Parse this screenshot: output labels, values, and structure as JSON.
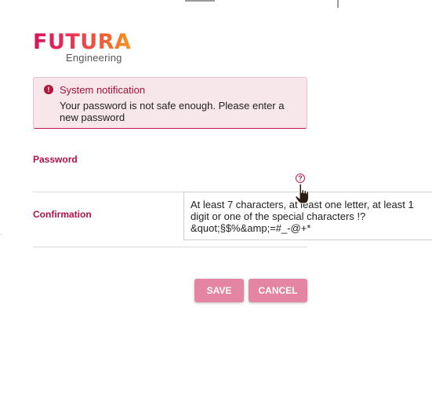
{
  "logo": {
    "brand": "FUTURA",
    "subtitle": "Engineering"
  },
  "notification": {
    "icon": "exclamation-icon",
    "title": "System notification",
    "message": "Your password is not safe enough. Please enter a new password"
  },
  "form": {
    "password_label": "Password",
    "confirmation_label": "Confirmation",
    "help_icon": "question-mark-icon"
  },
  "tooltip": {
    "text": "At least 7 characters, at least one letter, at least 1 digit or one of the special characters !?&quot;§$%&amp;=#_-@+*"
  },
  "buttons": {
    "save": "SAVE",
    "cancel": "CANCEL"
  },
  "colors": {
    "accent": "#c8174f",
    "button": "#e585a4",
    "notification_bg": "#f7e6ea"
  }
}
